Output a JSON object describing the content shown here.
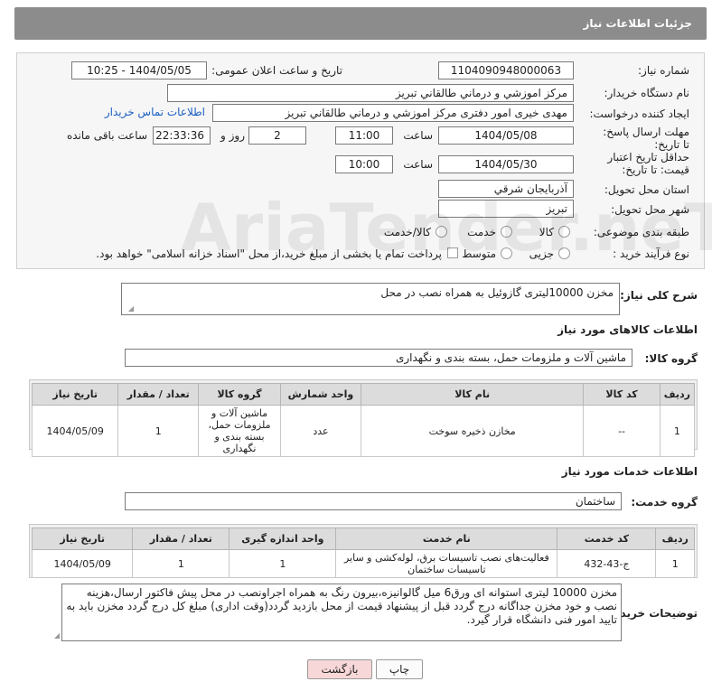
{
  "header": {
    "title": "جزئیات اطلاعات نیاز"
  },
  "form": {
    "need_number": {
      "label": "شماره نیاز:",
      "value": "1104090948000063"
    },
    "announce_datetime": {
      "label": "تاریخ و ساعت اعلان عمومی:",
      "value": "1404/05/05 - 10:25"
    },
    "buyer_org": {
      "label": "نام دستگاه خریدار:",
      "value": "مرکز اموزشي و درماني طالقاني تبريز"
    },
    "requester": {
      "label": "ایجاد کننده درخواست:",
      "value": "مهدی خیری امور دفتری مرکز اموزشي و درماني طالقاني تبريز",
      "contact_link": "اطلاعات تماس خریدار"
    },
    "reply_deadline": {
      "label": "مهلت ارسال پاسخ: تا تاریخ:",
      "date": "1404/05/08",
      "time_label": "ساعت",
      "time": "11:00",
      "days": "2",
      "days_label": "روز و",
      "remaining": "22:33:36",
      "remaining_label": "ساعت باقی مانده"
    },
    "price_validity": {
      "label": "حداقل تاریخ اعتبار قیمت: تا تاریخ:",
      "date": "1404/05/30",
      "time_label": "ساعت",
      "time": "10:00"
    },
    "province": {
      "label": "استان محل تحویل:",
      "value": "آذربايجان شرقي"
    },
    "city": {
      "label": "شهر محل تحویل:",
      "value": "تبريز"
    },
    "category": {
      "label": "طبقه بندی موضوعی:",
      "options": [
        "کالا",
        "خدمت",
        "کالا/خدمت"
      ]
    },
    "purchase_type": {
      "label": "نوع فرآیند خرید :",
      "options": [
        "جزیی",
        "متوسط"
      ],
      "note": "پرداخت تمام یا بخشی از مبلغ خرید،از محل \"اسناد خزانه اسلامی\" خواهد بود."
    }
  },
  "description": {
    "label": "شرح کلی نیاز:",
    "value": "مخزن 10000لیتری گازوئیل به همراه نصب در محل"
  },
  "goods": {
    "title": "اطلاعات کالاهای مورد نیاز",
    "group_label": "گروه کالا:",
    "group_value": "ماشین آلات و ملزومات حمل، بسته بندی و نگهداری",
    "columns": [
      "ردیف",
      "کد کالا",
      "نام کالا",
      "واحد شمارش",
      "گروه کالا",
      "تعداد / مقدار",
      "تاریخ نیاز"
    ],
    "rows": [
      [
        "1",
        "--",
        "مخازن ذخیره سوخت",
        "عدد",
        "ماشین آلات و ملزومات حمل، بسته بندی و نگهداری",
        "1",
        "1404/05/09"
      ]
    ]
  },
  "services": {
    "title": "اطلاعات خدمات مورد نیاز",
    "group_label": "گروه خدمت:",
    "group_value": "ساختمان",
    "columns": [
      "ردیف",
      "کد خدمت",
      "نام خدمت",
      "واحد اندازه گیری",
      "تعداد / مقدار",
      "تاریخ نیاز"
    ],
    "rows": [
      [
        "1",
        "ج-43-432",
        "فعالیت‌های نصب تاسیسات برق، لوله‌کشی و سایر تاسیسات ساختمان",
        "1",
        "1",
        "1404/05/09"
      ]
    ]
  },
  "buyer_notes": {
    "label": "توضیحات خریدار:",
    "value": "مخزن 10000 لیتری استوانه ای ورق6 میل گالوانیزه،بیرون رنگ به همراه اجرا‌ونصب در محل پیش فاکتور ارسال،هزینه نصب و خود مخزن جداگانه درج گردد قبل از پیشنهاد قیمت از محل بازدید گردد(وقت اداری) مبلغ کل درج گردد مخزن باید به تایید امور فنی دانشگاه قرار گیرد."
  },
  "buttons": {
    "print": "چاپ",
    "back": "بازگشت"
  },
  "watermark": {
    "text": "AriaTender.neT"
  },
  "colors": {
    "header_bg": "#8c8c8c",
    "link": "#1b5fc2",
    "back_button_bg": "#f7d7d7"
  }
}
